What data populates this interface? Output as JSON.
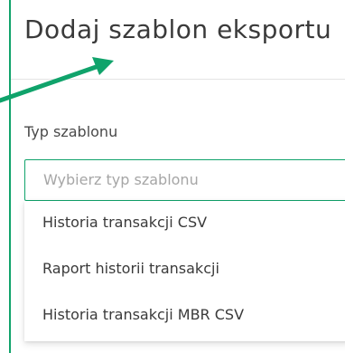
{
  "dialog": {
    "title": "Dodaj szablon eksportu"
  },
  "form": {
    "field_label": "Typ szablonu",
    "select_placeholder": "Wybierz typ szablonu",
    "options": [
      "Historia transakcji CSV",
      "Raport historii transakcji",
      "Historia transakcji MBR CSV"
    ]
  },
  "colors": {
    "accent": "#10a36b",
    "arrow": "#10a36b"
  },
  "icons": {
    "pointer": "arrow-annotation-icon"
  }
}
